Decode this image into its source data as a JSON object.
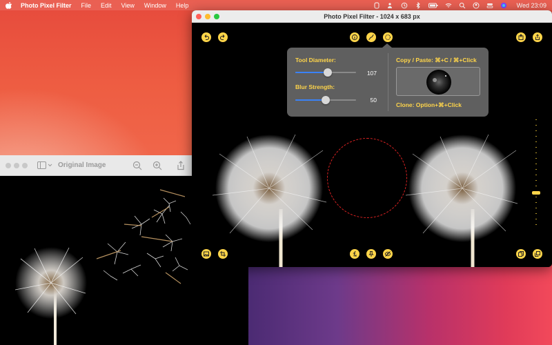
{
  "menubar": {
    "app_name": "Photo Pixel Filter",
    "items": [
      "File",
      "Edit",
      "View",
      "Window",
      "Help"
    ],
    "clock": "Wed 23:09",
    "status_icons": [
      "ear-icon",
      "people-icon",
      "time-machine-icon",
      "bluetooth-icon",
      "battery-icon",
      "wifi-icon",
      "spotlight-icon",
      "profile-icon",
      "control-center-icon",
      "siri-icon"
    ]
  },
  "original_window": {
    "title": "Original Image"
  },
  "main_window": {
    "title": "Photo Pixel Filter - 1024 x 683 px",
    "toolbar_top_left": [
      "undo-icon",
      "redo-icon"
    ],
    "toolbar_top_center": [
      "info-icon",
      "curve-icon",
      "brush-circle-icon"
    ],
    "toolbar_top_right": [
      "export-icon",
      "share-icon"
    ],
    "toolbar_bottom_left": [
      "image-icon",
      "crop-icon"
    ],
    "toolbar_bottom_center": [
      "function-icon",
      "pin-icon",
      "hide-icon"
    ],
    "toolbar_bottom_right": [
      "copy-icon",
      "duplicate-icon"
    ]
  },
  "popover": {
    "tool_diameter_label": "Tool Diameter:",
    "tool_diameter_value": "107",
    "tool_diameter_fraction": 0.53,
    "blur_strength_label": "Blur Strength:",
    "blur_strength_value": "50",
    "blur_strength_fraction": 0.5,
    "copy_paste_label": "Copy / Paste: ⌘+C / ⌘+Click",
    "clone_label": "Clone: Option+⌘+Click"
  },
  "side_slider_fraction": 0.65,
  "colors": {
    "accent": "#ffd54a",
    "slider_fill": "#3a82f7",
    "brush_circle": "#dd2222"
  }
}
